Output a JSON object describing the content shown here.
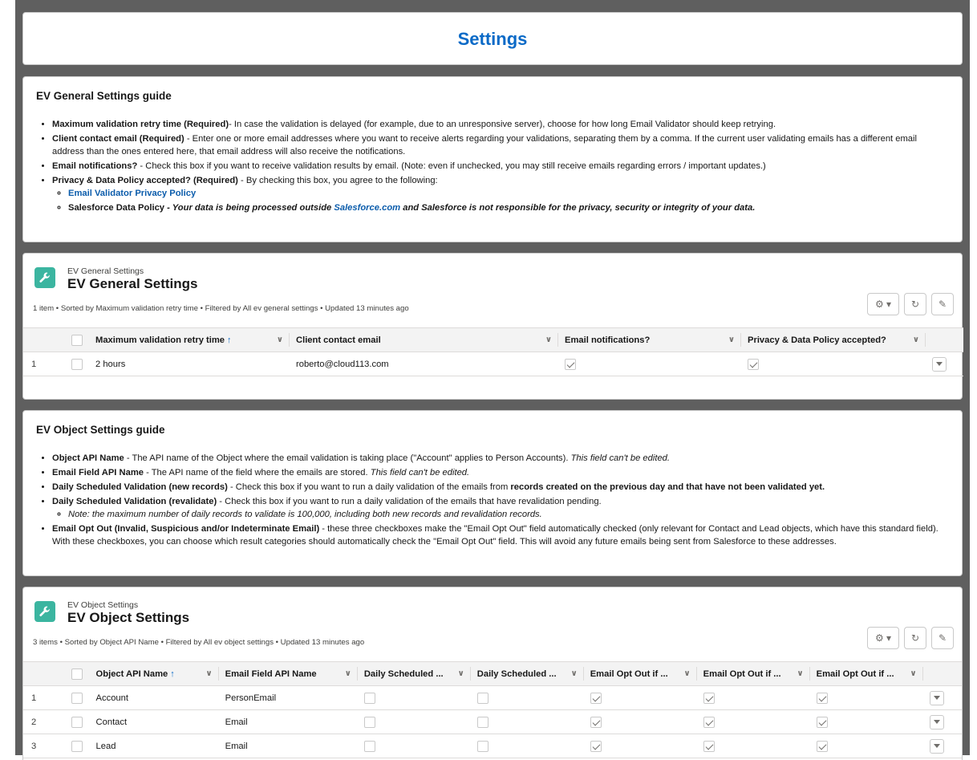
{
  "page": {
    "title": "Settings"
  },
  "general_guide": {
    "title": "EV General Settings guide",
    "items": [
      {
        "term": "Maximum validation retry time (Required)",
        "desc": "- In case the validation is delayed (for example, due to an unresponsive server), choose for how long Email Validator should keep retrying."
      },
      {
        "term": "Client contact email (Required)",
        "desc": " - Enter one or more email addresses where you want to receive alerts regarding your validations, separating them by a comma. If the current user validating emails has a different email address than the ones entered here, that email address will also receive the notifications."
      },
      {
        "term": "Email notifications?",
        "desc": " - Check this box if you want to receive validation results by email. (Note: even if unchecked, you may still receive emails regarding errors / important updates.)"
      },
      {
        "term": "Privacy & Data Policy accepted? (Required)",
        "desc": " - By checking this box, you agree to the following:"
      }
    ],
    "privacy_link": "Email Validator Privacy Policy",
    "sf_policy_term": "Salesforce Data Policy",
    "sf_policy_pre": " - Your data is being processed outside ",
    "sf_policy_link": "Salesforce.com",
    "sf_policy_post": " and Salesforce is not responsible for the privacy, security or integrity of your data."
  },
  "general_list": {
    "subtitle": "EV General Settings",
    "title": "EV General Settings",
    "meta": "1 item • Sorted by Maximum validation retry time • Filtered by All ev general settings • Updated 13 minutes ago",
    "columns": [
      "Maximum validation retry time",
      "Client contact email",
      "Email notifications?",
      "Privacy & Data Policy accepted?"
    ],
    "rows": [
      {
        "num": "1",
        "retry": "2 hours",
        "email": "roberto@cloud113.com",
        "notify": true,
        "privacy": true
      }
    ]
  },
  "object_guide": {
    "title": "EV Object Settings guide",
    "items": {
      "object_api_term": "Object API Name",
      "object_api_desc": " - The API name of the Object where the email validation is taking place (\"Account\" applies to Person Accounts). ",
      "object_api_em": "This field can't be edited.",
      "field_api_term": "Email Field API Name",
      "field_api_desc": " - The API name of the field where the emails are stored. ",
      "field_api_em": "This field can't be edited.",
      "daily_new_term": "Daily Scheduled Validation (new records)",
      "daily_new_desc": " - Check this box if you want to run a daily validation of the emails from ",
      "daily_new_bold": "records created on the previous day and that have not been validated yet.",
      "daily_re_term": "Daily Scheduled Validation (revalidate)",
      "daily_re_desc": " - Check this box if you want to run a daily validation of the emails that have revalidation pending.",
      "daily_note": "Note: the maximum number of daily records to validate is 100,000, including both new records and revalidation records.",
      "optout_term": "Email Opt Out (Invalid, Suspicious and/or Indeterminate Email)",
      "optout_desc": " - these three checkboxes make the \"Email Opt Out\" field automatically checked (only relevant for Contact and Lead objects, which have this standard field). With these checkboxes, you can choose which result categories should automatically check the \"Email Opt Out\" field. This will avoid any future emails being sent from Salesforce to these addresses."
    }
  },
  "object_list": {
    "subtitle": "EV Object Settings",
    "title": "EV Object Settings",
    "meta": "3 items • Sorted by Object API Name • Filtered by All ev object settings • Updated 13 minutes ago",
    "columns": [
      "Object API Name",
      "Email Field API Name",
      "Daily Scheduled ...",
      "Daily Scheduled ...",
      "Email Opt Out if ...",
      "Email Opt Out if ...",
      "Email Opt Out if ..."
    ],
    "rows": [
      {
        "num": "1",
        "object": "Account",
        "field": "PersonEmail",
        "daily_new": false,
        "daily_re": false,
        "opt1": true,
        "opt2": true,
        "opt3": true
      },
      {
        "num": "2",
        "object": "Contact",
        "field": "Email",
        "daily_new": false,
        "daily_re": false,
        "opt1": true,
        "opt2": true,
        "opt3": true
      },
      {
        "num": "3",
        "object": "Lead",
        "field": "Email",
        "daily_new": false,
        "daily_re": false,
        "opt1": true,
        "opt2": true,
        "opt3": true
      }
    ]
  },
  "icons": {
    "list_icon": "wrench-icon",
    "gear": "gear-icon",
    "refresh": "refresh-icon",
    "edit": "pencil-icon",
    "sort": "arrow-up-icon",
    "column_menu": "chevron-down-icon",
    "row_menu": "caret-down-icon"
  },
  "colors": {
    "accent": "#0b6ac7",
    "icon_bg": "#3bb5a0",
    "frame": "#5f5f5f"
  }
}
